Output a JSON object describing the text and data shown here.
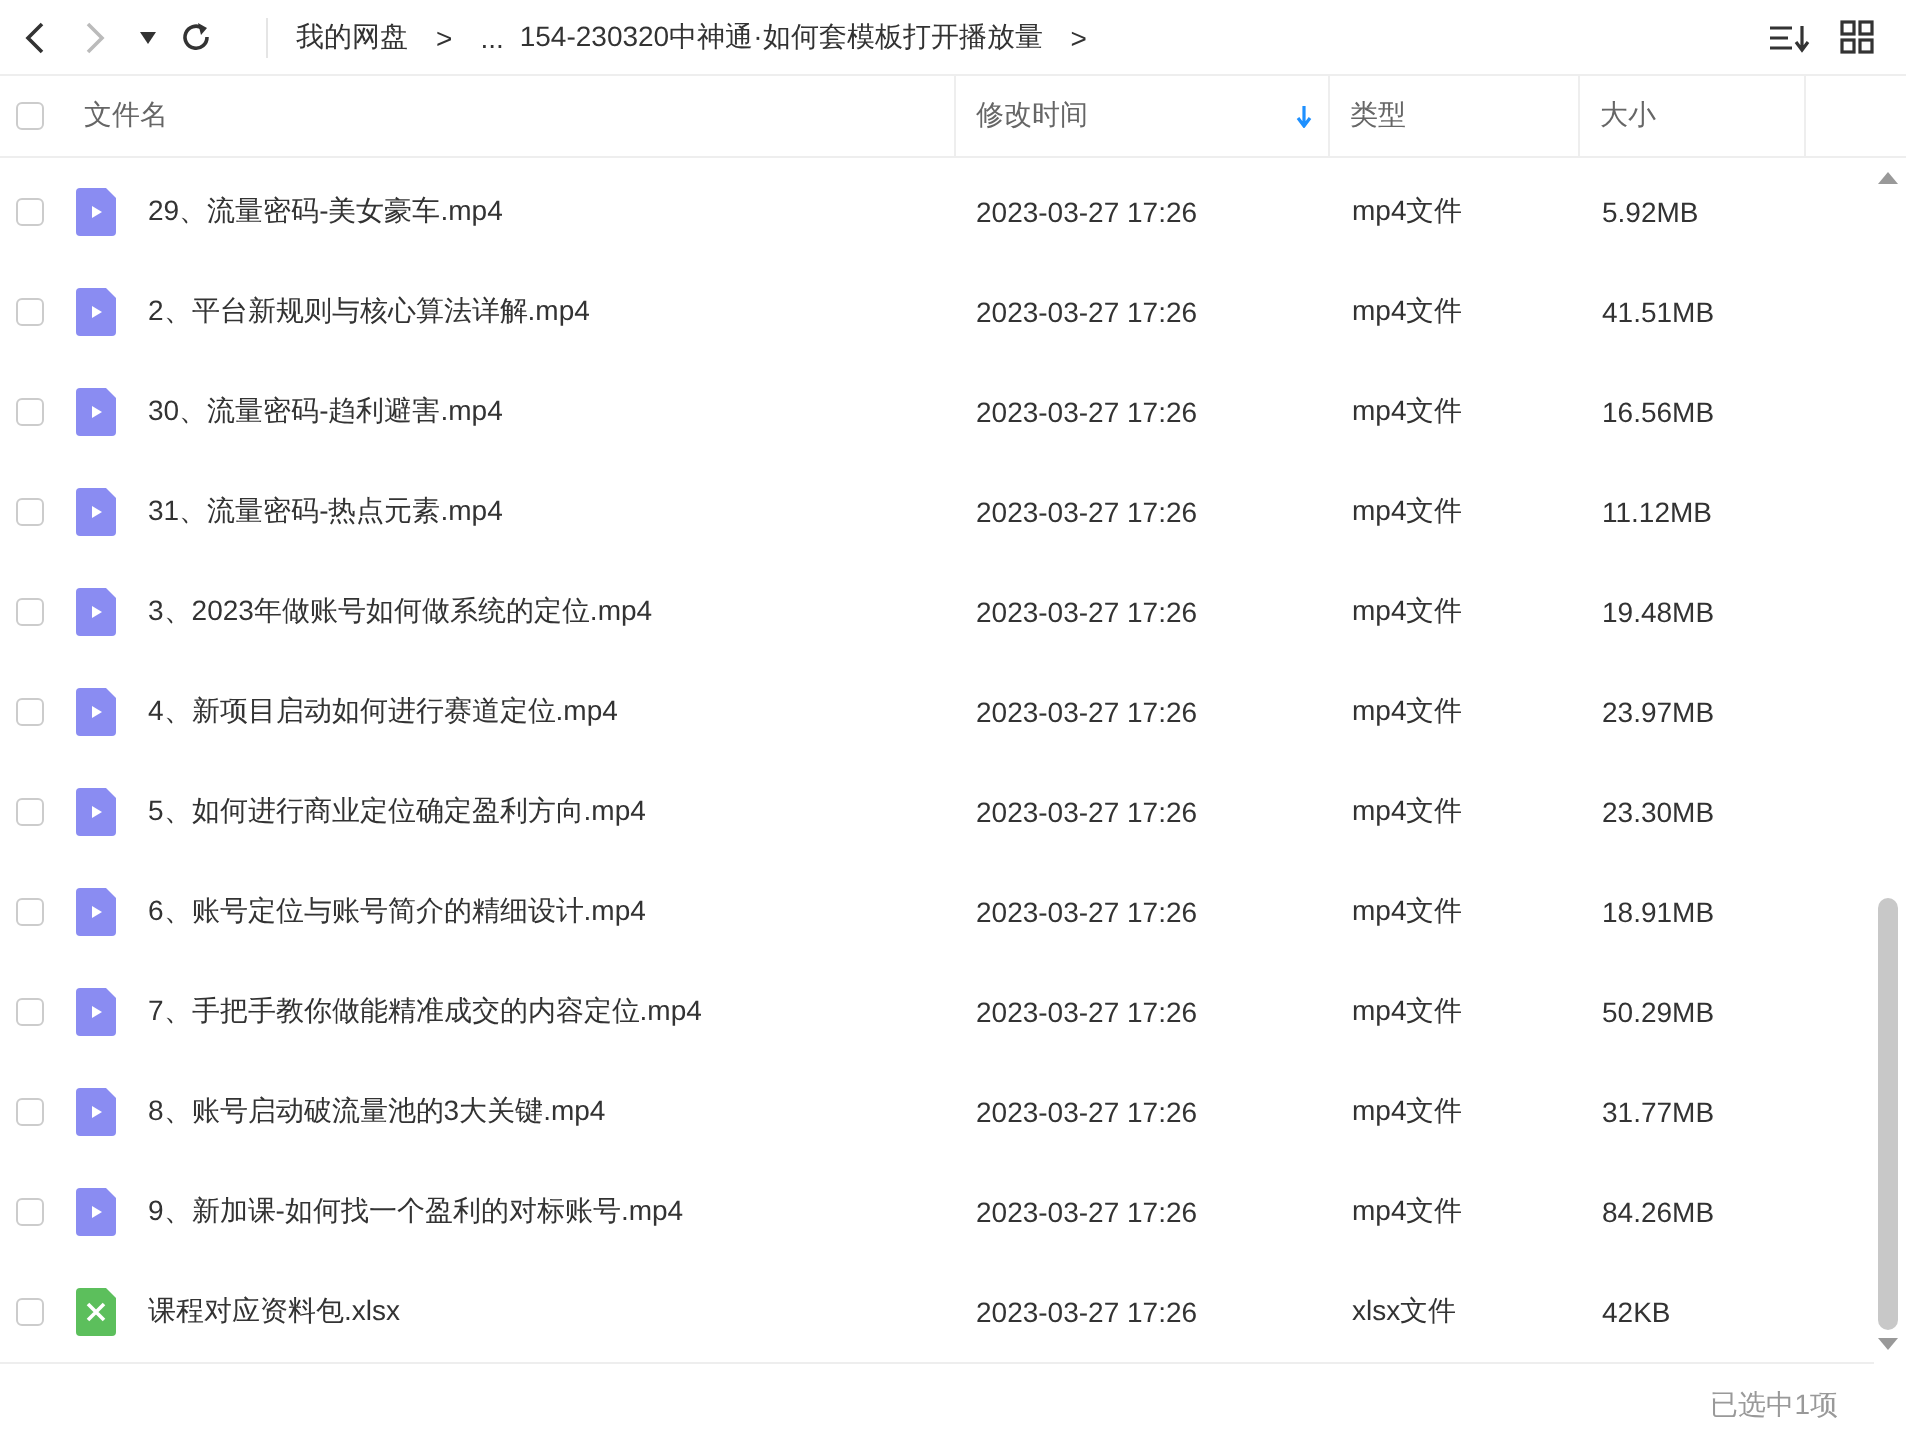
{
  "toolbar": {
    "breadcrumb": [
      {
        "label": "我的网盘",
        "separator": ">"
      },
      {
        "label": "..."
      },
      {
        "label": "154-230320中神通·如何套模板打开播放量",
        "separator": ">"
      }
    ]
  },
  "table": {
    "all_checked": false,
    "columns": [
      {
        "label": "文件名",
        "sorted": false
      },
      {
        "label": "修改时间",
        "sorted": true
      },
      {
        "label": "类型",
        "sorted": false
      },
      {
        "label": "大小",
        "sorted": false
      }
    ],
    "rows": [
      {
        "kind": "video",
        "name": "29、流量密码-美女豪车.mp4",
        "modified": "2023-03-27 17:26",
        "type": "mp4文件",
        "size": "5.92MB",
        "checked": false
      },
      {
        "kind": "video",
        "name": "2、平台新规则与核心算法详解.mp4",
        "modified": "2023-03-27 17:26",
        "type": "mp4文件",
        "size": "41.51MB",
        "checked": false
      },
      {
        "kind": "video",
        "name": "30、流量密码-趋利避害.mp4",
        "modified": "2023-03-27 17:26",
        "type": "mp4文件",
        "size": "16.56MB",
        "checked": false
      },
      {
        "kind": "video",
        "name": "31、流量密码-热点元素.mp4",
        "modified": "2023-03-27 17:26",
        "type": "mp4文件",
        "size": "11.12MB",
        "checked": false
      },
      {
        "kind": "video",
        "name": "3、2023年做账号如何做系统的定位.mp4",
        "modified": "2023-03-27 17:26",
        "type": "mp4文件",
        "size": "19.48MB",
        "checked": false
      },
      {
        "kind": "video",
        "name": "4、新项目启动如何进行赛道定位.mp4",
        "modified": "2023-03-27 17:26",
        "type": "mp4文件",
        "size": "23.97MB",
        "checked": false
      },
      {
        "kind": "video",
        "name": "5、如何进行商业定位确定盈利方向.mp4",
        "modified": "2023-03-27 17:26",
        "type": "mp4文件",
        "size": "23.30MB",
        "checked": false
      },
      {
        "kind": "video",
        "name": "6、账号定位与账号简介的精细设计.mp4",
        "modified": "2023-03-27 17:26",
        "type": "mp4文件",
        "size": "18.91MB",
        "checked": false
      },
      {
        "kind": "video",
        "name": "7、手把手教你做能精准成交的内容定位.mp4",
        "modified": "2023-03-27 17:26",
        "type": "mp4文件",
        "size": "50.29MB",
        "checked": false
      },
      {
        "kind": "video",
        "name": "8、账号启动破流量池的3大关键.mp4",
        "modified": "2023-03-27 17:26",
        "type": "mp4文件",
        "size": "31.77MB",
        "checked": false
      },
      {
        "kind": "video",
        "name": "9、新加课-如何找一个盈利的对标账号.mp4",
        "modified": "2023-03-27 17:26",
        "type": "mp4文件",
        "size": "84.26MB",
        "checked": false
      },
      {
        "kind": "spreadsheet",
        "name": "课程对应资料包.xlsx",
        "modified": "2023-03-27 17:26",
        "type": "xlsx文件",
        "size": "42KB",
        "checked": false
      }
    ]
  },
  "status_bar": {
    "selection": "已选中1项"
  }
}
